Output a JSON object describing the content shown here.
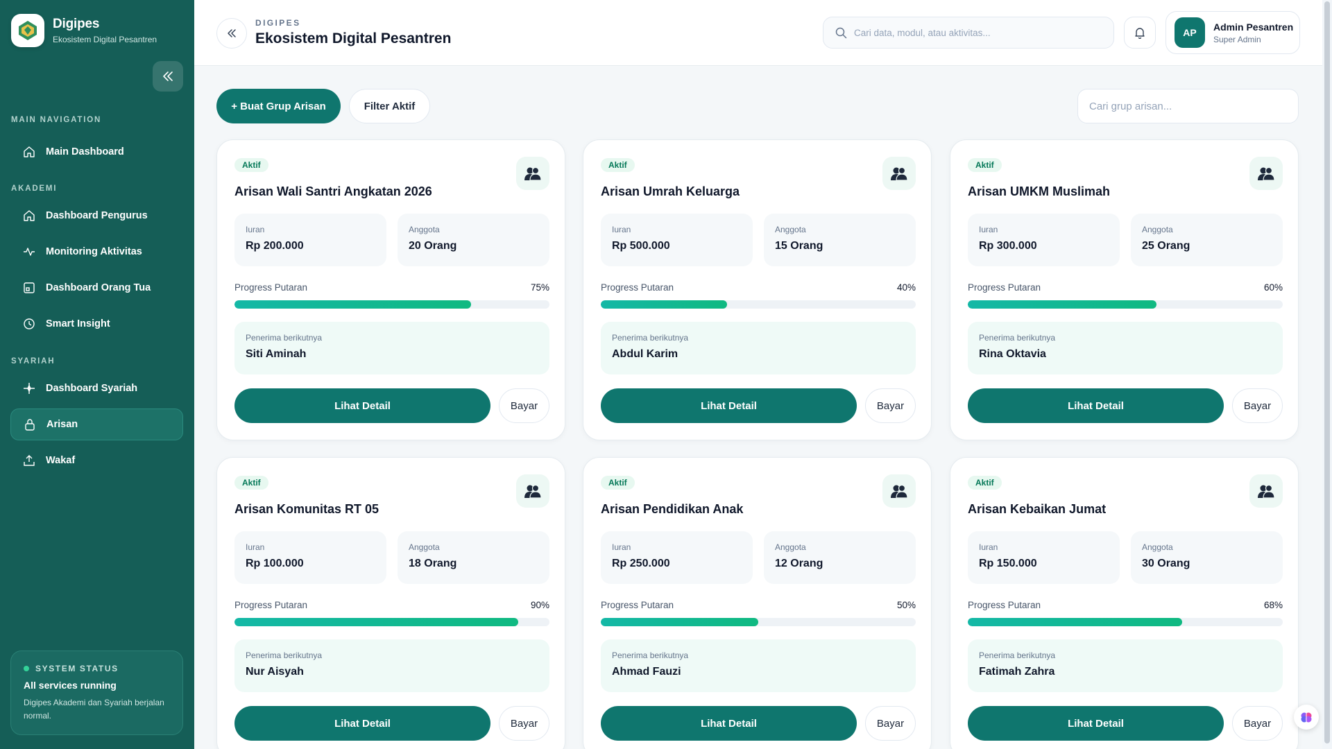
{
  "brand": {
    "name": "Digipes",
    "subtitle": "Ekosistem Digital Pesantren",
    "logo_text": "DIGIPES"
  },
  "nav": {
    "sections": [
      {
        "label": "MAIN NAVIGATION"
      },
      {
        "label": "AKADEMI"
      },
      {
        "label": "SYARIAH"
      }
    ],
    "items": [
      {
        "label": "Main Dashboard",
        "icon": "home-icon"
      },
      {
        "label": "Dashboard Pengurus",
        "icon": "home-icon"
      },
      {
        "label": "Monitoring Aktivitas",
        "icon": "activity-icon"
      },
      {
        "label": "Dashboard Orang Tua",
        "icon": "window-icon"
      },
      {
        "label": "Smart Insight",
        "icon": "clock-icon"
      },
      {
        "label": "Dashboard Syariah",
        "icon": "sparkle-icon"
      },
      {
        "label": "Arisan",
        "icon": "lock-icon",
        "active": true
      },
      {
        "label": "Wakaf",
        "icon": "upload-box-icon"
      }
    ]
  },
  "system_status": {
    "label": "SYSTEM STATUS",
    "title": "All services running",
    "desc": "Digipes Akademi dan Syariah berjalan normal."
  },
  "header": {
    "kicker": "DIGIPES",
    "title": "Ekosistem Digital Pesantren",
    "search_placeholder": "Cari data, modul, atau aktivitas...",
    "user_initials": "AP",
    "user_name": "Admin Pesantren",
    "user_role": "Super Admin"
  },
  "toolbar": {
    "create_label": "+ Buat Grup Arisan",
    "filter_label": "Filter Aktif",
    "search_placeholder": "Cari grup arisan..."
  },
  "cards": [
    {
      "badge": "Aktif",
      "title": "Arisan Wali Santri Angkatan 2026",
      "iuran_label": "Iuran",
      "iuran": "Rp 200.000",
      "anggota_label": "Anggota",
      "anggota": "20 Orang",
      "progress_label": "Progress Putaran",
      "progress_text": "75%",
      "progress": 75,
      "recipient_label": "Penerima berikutnya",
      "recipient": "Siti Aminah",
      "detail_label": "Lihat Detail",
      "pay_label": "Bayar"
    },
    {
      "badge": "Aktif",
      "title": "Arisan Umrah Keluarga",
      "iuran_label": "Iuran",
      "iuran": "Rp 500.000",
      "anggota_label": "Anggota",
      "anggota": "15 Orang",
      "progress_label": "Progress Putaran",
      "progress_text": "40%",
      "progress": 40,
      "recipient_label": "Penerima berikutnya",
      "recipient": "Abdul Karim",
      "detail_label": "Lihat Detail",
      "pay_label": "Bayar"
    },
    {
      "badge": "Aktif",
      "title": "Arisan UMKM Muslimah",
      "iuran_label": "Iuran",
      "iuran": "Rp 300.000",
      "anggota_label": "Anggota",
      "anggota": "25 Orang",
      "progress_label": "Progress Putaran",
      "progress_text": "60%",
      "progress": 60,
      "recipient_label": "Penerima berikutnya",
      "recipient": "Rina Oktavia",
      "detail_label": "Lihat Detail",
      "pay_label": "Bayar"
    },
    {
      "badge": "Aktif",
      "title": "Arisan Komunitas RT 05",
      "iuran_label": "Iuran",
      "iuran": "Rp 100.000",
      "anggota_label": "Anggota",
      "anggota": "18 Orang",
      "progress_label": "Progress Putaran",
      "progress_text": "90%",
      "progress": 90,
      "recipient_label": "Penerima berikutnya",
      "recipient": "Nur Aisyah",
      "detail_label": "Lihat Detail",
      "pay_label": "Bayar"
    },
    {
      "badge": "Aktif",
      "title": "Arisan Pendidikan Anak",
      "iuran_label": "Iuran",
      "iuran": "Rp 250.000",
      "anggota_label": "Anggota",
      "anggota": "12 Orang",
      "progress_label": "Progress Putaran",
      "progress_text": "50%",
      "progress": 50,
      "recipient_label": "Penerima berikutnya",
      "recipient": "Ahmad Fauzi",
      "detail_label": "Lihat Detail",
      "pay_label": "Bayar"
    },
    {
      "badge": "Aktif",
      "title": "Arisan Kebaikan Jumat",
      "iuran_label": "Iuran",
      "iuran": "Rp 150.000",
      "anggota_label": "Anggota",
      "anggota": "30 Orang",
      "progress_label": "Progress Putaran",
      "progress_text": "68%",
      "progress": 68,
      "recipient_label": "Penerima berikutnya",
      "recipient": "Fatimah Zahra",
      "detail_label": "Lihat Detail",
      "pay_label": "Bayar"
    }
  ],
  "colors": {
    "sidebar": "#155e57",
    "primary": "#0f766e",
    "progress": "#10b981",
    "badge_bg": "#e7f8f0"
  }
}
